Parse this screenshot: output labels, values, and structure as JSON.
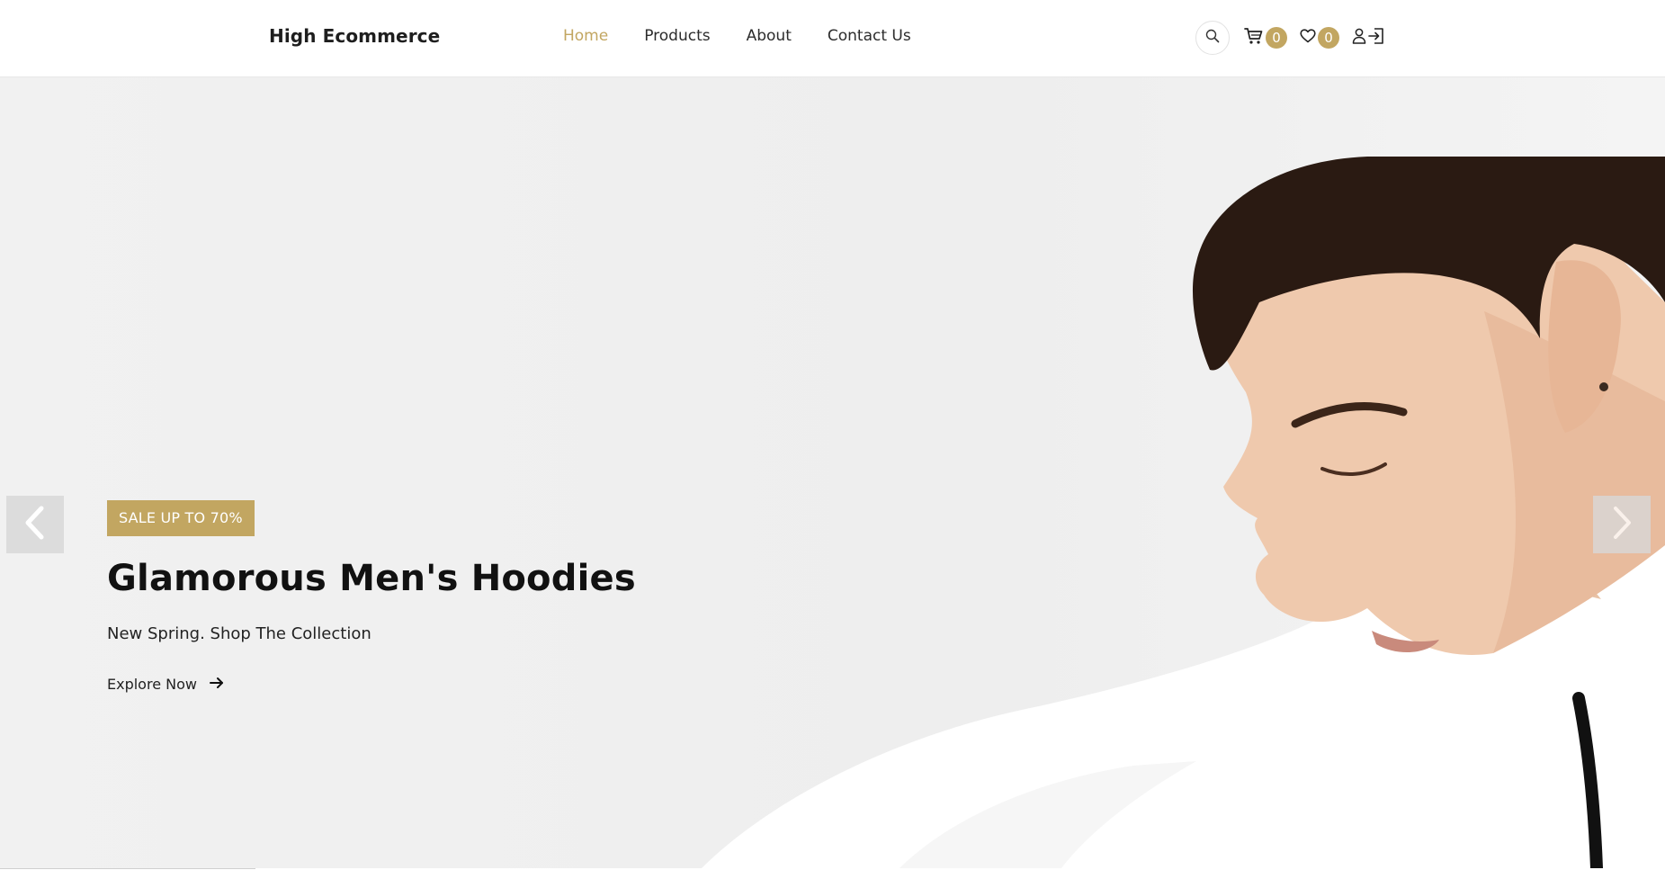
{
  "header": {
    "logo": "High Ecommerce",
    "nav": [
      {
        "label": "Home",
        "active": true
      },
      {
        "label": "Products",
        "active": false
      },
      {
        "label": "About",
        "active": false
      },
      {
        "label": "Contact Us",
        "active": false
      }
    ],
    "cart_count": "0",
    "wishlist_count": "0",
    "icons": [
      "search-icon",
      "cart-icon",
      "heart-icon",
      "user-icon",
      "login-icon"
    ]
  },
  "hero": {
    "tag": "SALE UP TO 70%",
    "title": "Glamorous Men's Hoodies",
    "subtitle": "New Spring. Shop The Collection",
    "cta": "Explore Now",
    "image": "man-in-white-hoodie-photo"
  },
  "colors": {
    "accent": "#c2a661",
    "text": "#1e1e1e",
    "hero_bg": "#f0f0f0"
  }
}
